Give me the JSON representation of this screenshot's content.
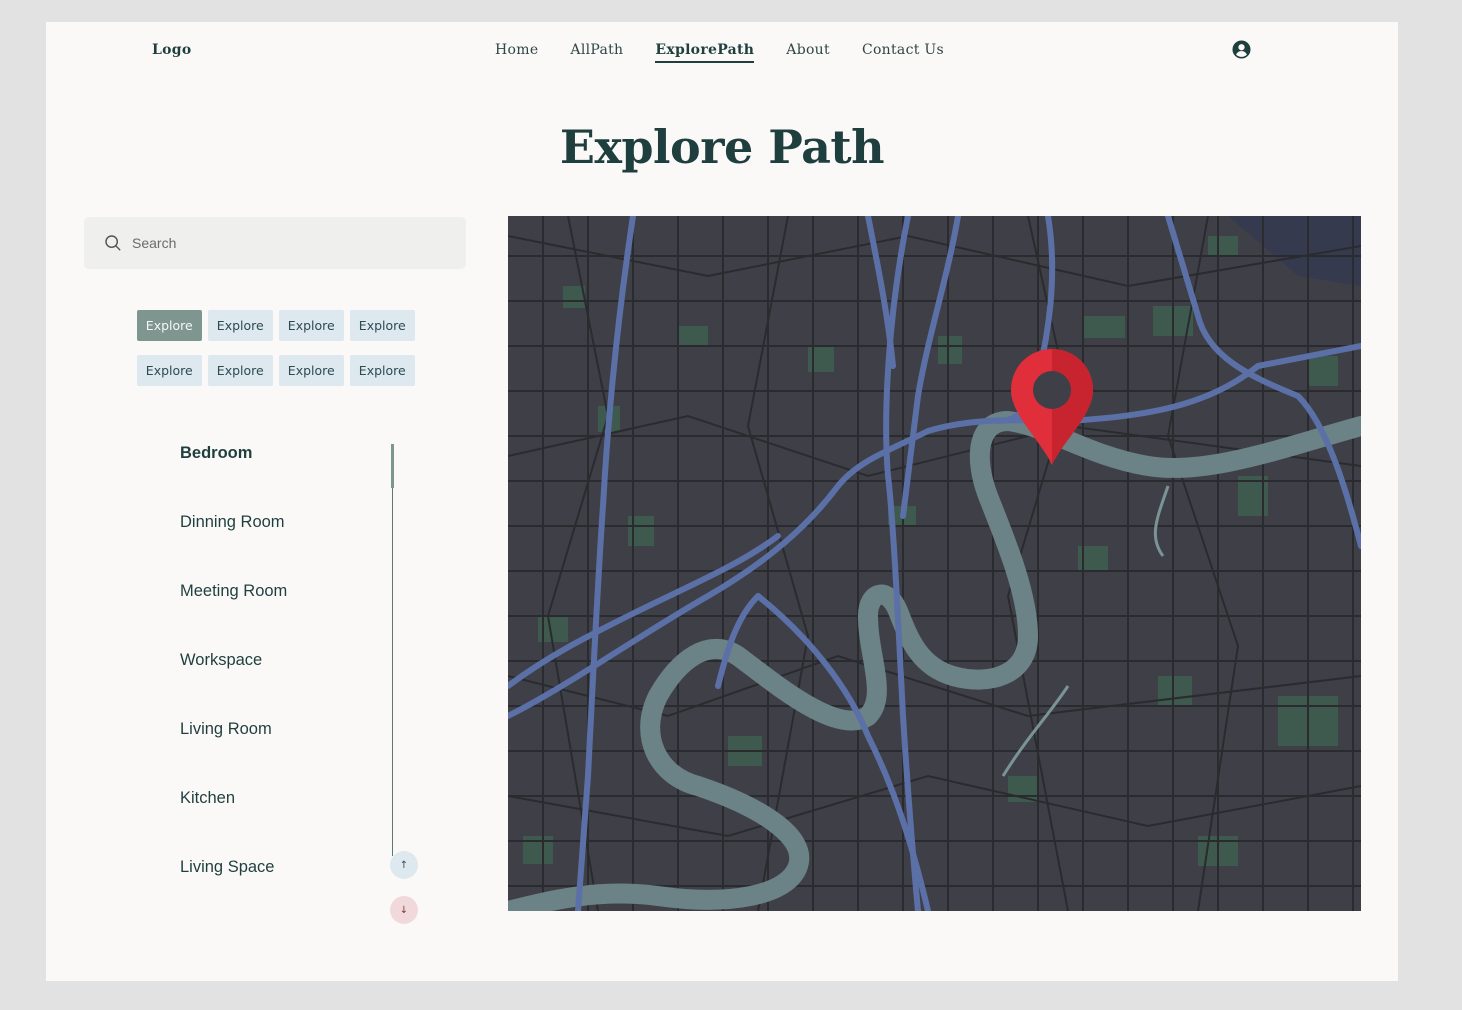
{
  "header": {
    "logo": "Logo",
    "nav": [
      "Home",
      "AllPath",
      "ExplorePath",
      "About",
      "Contact Us"
    ],
    "active_nav": "ExplorePath",
    "user_icon": "user-circle-icon"
  },
  "main": {
    "title": "Explore Path",
    "search": {
      "placeholder": "Search",
      "icon": "search-icon"
    },
    "chips": [
      "Explore",
      "Explore",
      "Explore",
      "Explore",
      "Explore",
      "Explore",
      "Explore",
      "Explore"
    ],
    "active_chip_index": 0,
    "rooms": [
      "Bedroom",
      "Dinning Room",
      "Meeting Room",
      "Workspace",
      "Living Room",
      "Kitchen",
      "Living Space"
    ],
    "active_room": "Bedroom",
    "scroll": {
      "up_label": "↑",
      "down_label": "↓"
    },
    "map": {
      "marker_icon": "map-pin-icon",
      "marker_color": "#e02f3a"
    }
  },
  "colors": {
    "accent": "#1f3f3f",
    "chip_bg": "#dde8ef",
    "chip_active_bg": "#7f9590",
    "map_bg": "#3f4047",
    "road": "#5c70a8",
    "river": "#6b8286",
    "park": "#3e5a4e"
  }
}
